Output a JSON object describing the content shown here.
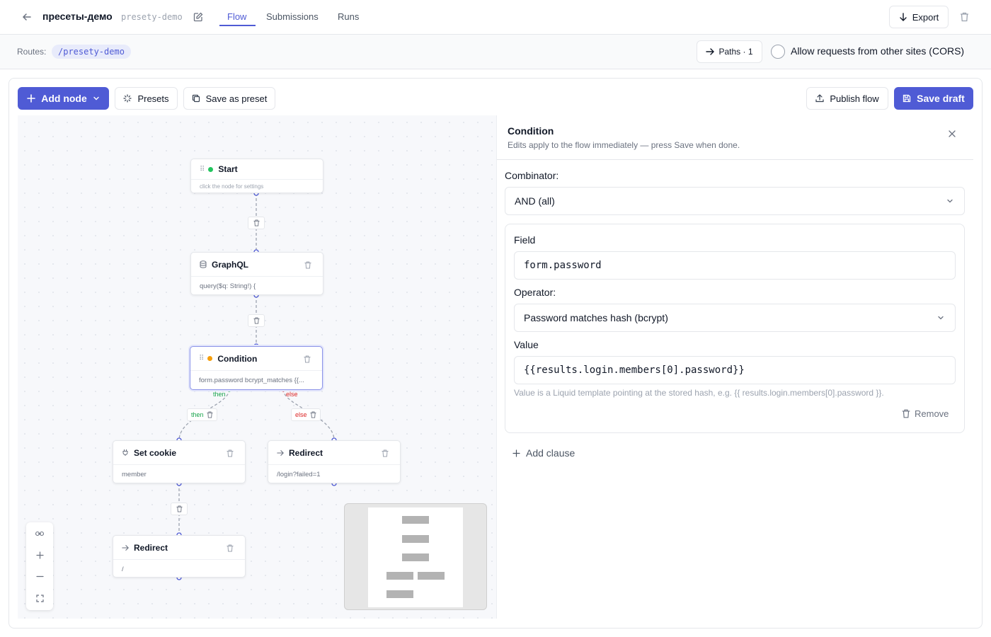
{
  "header": {
    "title": "пресеты-демо",
    "slug": "presety-demo",
    "tabs": [
      {
        "label": "Flow",
        "active": true
      },
      {
        "label": "Submissions",
        "active": false
      },
      {
        "label": "Runs",
        "active": false
      }
    ],
    "export_label": "Export"
  },
  "routes": {
    "label": "Routes:",
    "path": "/presety-demo",
    "paths_label": "Paths · 1",
    "cors_label": "Allow requests from other sites (CORS)",
    "cors_enabled": false
  },
  "toolbar": {
    "add_node_label": "Add node",
    "presets_label": "Presets",
    "save_as_preset_label": "Save as preset",
    "publish_label": "Publish flow",
    "save_draft_label": "Save draft"
  },
  "canvas": {
    "nodes": [
      {
        "id": "start",
        "title": "Start",
        "subtitle": "click the node for settings",
        "status_color": "#22c55e"
      },
      {
        "id": "graphql",
        "title": "GraphQL",
        "subtitle": "query($q: String!) {"
      },
      {
        "id": "condition",
        "title": "Condition",
        "subtitle": "form.password bcrypt_matches {{...",
        "status_color": "#f59e0b",
        "selected": true
      },
      {
        "id": "setcookie",
        "title": "Set cookie",
        "subtitle": "member"
      },
      {
        "id": "redirect1",
        "title": "Redirect",
        "subtitle": "/login?failed=1"
      },
      {
        "id": "redirect2",
        "title": "Redirect",
        "subtitle": "/"
      }
    ],
    "edge_labels": {
      "then": "then",
      "else": "else"
    }
  },
  "panel": {
    "title": "Condition",
    "description": "Edits apply to the flow immediately — press Save when done.",
    "combinator_label": "Combinator:",
    "combinator_value": "AND (all)",
    "clause": {
      "field_label": "Field",
      "field_value": "form.password",
      "operator_label": "Operator:",
      "operator_value": "Password matches hash (bcrypt)",
      "value_label": "Value",
      "value_value": "{{results.login.members[0].password}}",
      "hint": "Value is a Liquid template pointing at the stored hash, e.g. {{ results.login.members[0].password }}.",
      "remove_label": "Remove"
    },
    "add_clause_label": "Add clause"
  },
  "colors": {
    "accent": "#4f5bd5",
    "then": "#22c55e",
    "else": "#ef4444"
  }
}
